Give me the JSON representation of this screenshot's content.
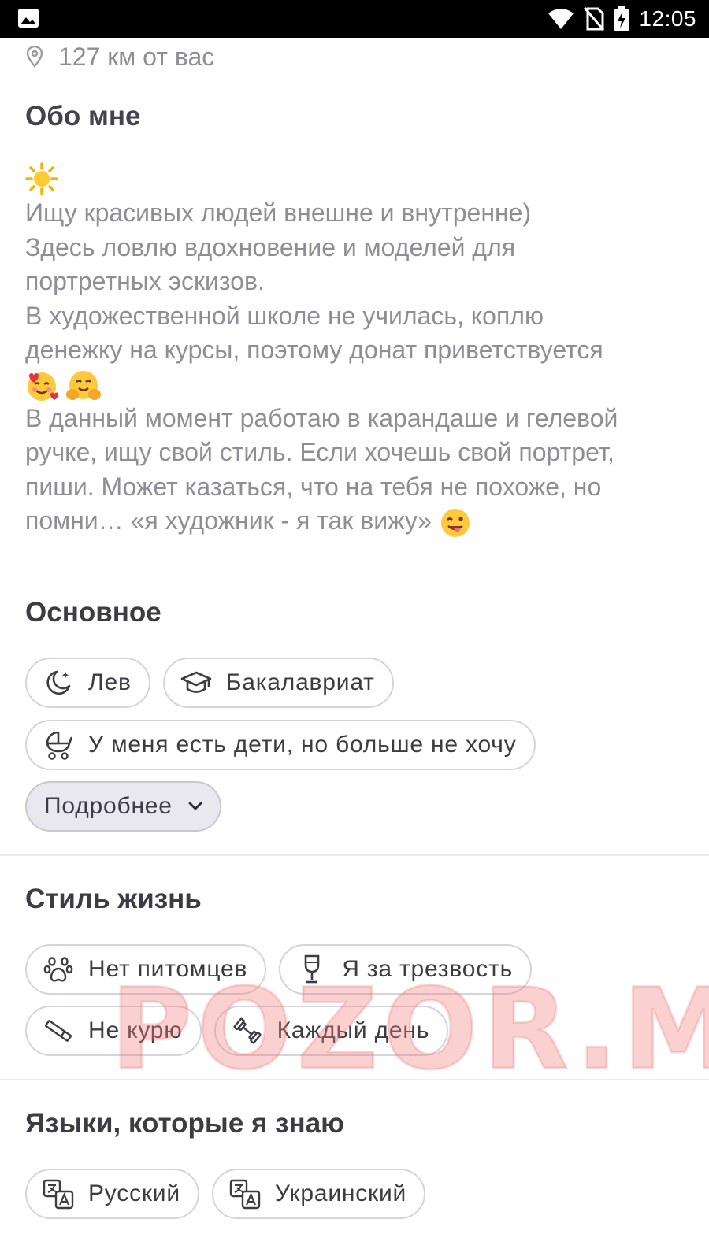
{
  "status_bar": {
    "time": "12:05",
    "icons": [
      "image-icon",
      "wifi-icon",
      "no-sim-icon",
      "battery-charging-icon"
    ]
  },
  "profile": {
    "location": "127 км от вас",
    "about_title": "Обо мне",
    "bio_lines": [
      "Ищу красивых людей внешне и внутренне)",
      "Здесь ловлю вдохновение и моделей для",
      "портретных эскизов.",
      "В художественной школе не училась, коплю",
      "денежку на курсы, поэтому донат приветствуется",
      "В данный момент работаю в карандаше и гелевой",
      "ручке, ищу свой стиль. Если хочешь свой портрет,",
      "пиши. Может казаться, что на тебя не похоже, но",
      "помни… «я художник - я так вижу»"
    ],
    "emojis": [
      "sun-emoji",
      "smiling-hearts-emoji",
      "hugging-emoji",
      "winking-tongue-emoji"
    ]
  },
  "basics": {
    "title": "Основное",
    "chips": {
      "zodiac": "Лев",
      "education": "Бакалавриат",
      "kids": "У меня есть дети, но больше не хочу"
    },
    "more_button": "Подробнее"
  },
  "lifestyle": {
    "title": "Стиль жизнь",
    "chips": {
      "pets": "Нет питомцев",
      "drinking": "Я за трезвость",
      "smoking": "Не курю",
      "workout": "Каждый день"
    }
  },
  "languages": {
    "title": "Языки, которые я знаю",
    "chips": [
      "Русский",
      "Украинский"
    ]
  },
  "watermark": "POZOR.ME"
}
